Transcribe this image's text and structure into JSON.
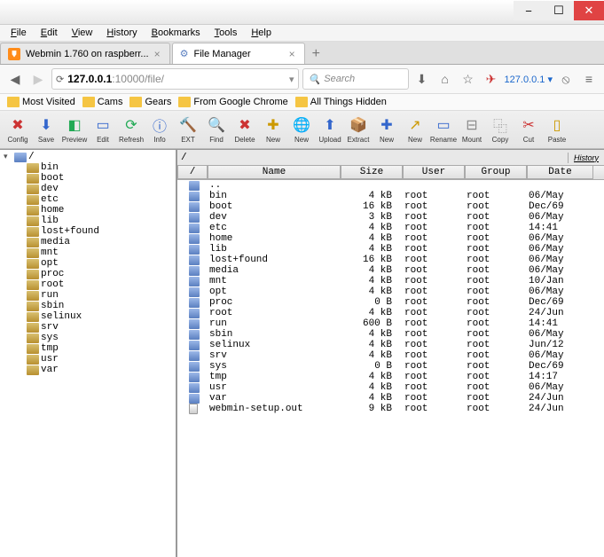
{
  "window": {
    "min": "−",
    "max": "☐",
    "close": "✕"
  },
  "menu": [
    "File",
    "Edit",
    "View",
    "History",
    "Bookmarks",
    "Tools",
    "Help"
  ],
  "tabs": [
    {
      "label": "Webmin 1.760 on raspberr...",
      "active": false
    },
    {
      "label": "File Manager",
      "active": true
    }
  ],
  "url": {
    "host": "127.0.0.1",
    "rest": ":10000/file/",
    "search_placeholder": "Search",
    "ip": "127.0.0.1"
  },
  "bookmarks": [
    "Most Visited",
    "Cams",
    "Gears",
    "From Google Chrome",
    "All Things Hidden"
  ],
  "tools": [
    {
      "l": "Config",
      "i": "✖",
      "c": "#c33"
    },
    {
      "l": "Save",
      "i": "⬇",
      "c": "#36c"
    },
    {
      "l": "Preview",
      "i": "◧",
      "c": "#2a5"
    },
    {
      "l": "Edit",
      "i": "▭",
      "c": "#36c"
    },
    {
      "l": "Refresh",
      "i": "⟳",
      "c": "#2a5"
    },
    {
      "l": "Info",
      "i": "ⓘ",
      "c": "#36c"
    },
    {
      "l": "EXT",
      "i": "🔨",
      "c": "#a63"
    },
    {
      "l": "Find",
      "i": "🔍",
      "c": "#888"
    },
    {
      "l": "Delete",
      "i": "✖",
      "c": "#c33"
    },
    {
      "l": "New",
      "i": "✚",
      "c": "#c90"
    },
    {
      "l": "New",
      "i": "🌐",
      "c": "#e70"
    },
    {
      "l": "Upload",
      "i": "⬆",
      "c": "#36c"
    },
    {
      "l": "Extract",
      "i": "📦",
      "c": "#a63"
    },
    {
      "l": "New",
      "i": "✚",
      "c": "#36c"
    },
    {
      "l": "New",
      "i": "↗",
      "c": "#c90"
    },
    {
      "l": "Rename",
      "i": "▭",
      "c": "#36c"
    },
    {
      "l": "Mount",
      "i": "⊟",
      "c": "#888"
    },
    {
      "l": "Copy",
      "i": "⿻",
      "c": "#888"
    },
    {
      "l": "Cut",
      "i": "✂",
      "c": "#c33"
    },
    {
      "l": "Paste",
      "i": "▯",
      "c": "#c90"
    }
  ],
  "tree_root": "/",
  "tree": [
    "bin",
    "boot",
    "dev",
    "etc",
    "home",
    "lib",
    "lost+found",
    "media",
    "mnt",
    "opt",
    "proc",
    "root",
    "run",
    "sbin",
    "selinux",
    "srv",
    "sys",
    "tmp",
    "usr",
    "var"
  ],
  "path": "/",
  "history_label": "History",
  "columns": {
    "name": "Name",
    "size": "Size",
    "user": "User",
    "group": "Group",
    "date": "Date"
  },
  "parent_row": "..",
  "files": [
    {
      "n": "bin",
      "s": "4 kB",
      "u": "root",
      "g": "root",
      "d": "06/May",
      "t": "d"
    },
    {
      "n": "boot",
      "s": "16 kB",
      "u": "root",
      "g": "root",
      "d": "Dec/69",
      "t": "d"
    },
    {
      "n": "dev",
      "s": "3 kB",
      "u": "root",
      "g": "root",
      "d": "06/May",
      "t": "d"
    },
    {
      "n": "etc",
      "s": "4 kB",
      "u": "root",
      "g": "root",
      "d": "14:41",
      "t": "d"
    },
    {
      "n": "home",
      "s": "4 kB",
      "u": "root",
      "g": "root",
      "d": "06/May",
      "t": "d"
    },
    {
      "n": "lib",
      "s": "4 kB",
      "u": "root",
      "g": "root",
      "d": "06/May",
      "t": "d"
    },
    {
      "n": "lost+found",
      "s": "16 kB",
      "u": "root",
      "g": "root",
      "d": "06/May",
      "t": "d"
    },
    {
      "n": "media",
      "s": "4 kB",
      "u": "root",
      "g": "root",
      "d": "06/May",
      "t": "d"
    },
    {
      "n": "mnt",
      "s": "4 kB",
      "u": "root",
      "g": "root",
      "d": "10/Jan",
      "t": "d"
    },
    {
      "n": "opt",
      "s": "4 kB",
      "u": "root",
      "g": "root",
      "d": "06/May",
      "t": "d"
    },
    {
      "n": "proc",
      "s": "0 B",
      "u": "root",
      "g": "root",
      "d": "Dec/69",
      "t": "d"
    },
    {
      "n": "root",
      "s": "4 kB",
      "u": "root",
      "g": "root",
      "d": "24/Jun",
      "t": "d"
    },
    {
      "n": "run",
      "s": "600 B",
      "u": "root",
      "g": "root",
      "d": "14:41",
      "t": "d"
    },
    {
      "n": "sbin",
      "s": "4 kB",
      "u": "root",
      "g": "root",
      "d": "06/May",
      "t": "d"
    },
    {
      "n": "selinux",
      "s": "4 kB",
      "u": "root",
      "g": "root",
      "d": "Jun/12",
      "t": "d"
    },
    {
      "n": "srv",
      "s": "4 kB",
      "u": "root",
      "g": "root",
      "d": "06/May",
      "t": "d"
    },
    {
      "n": "sys",
      "s": "0 B",
      "u": "root",
      "g": "root",
      "d": "Dec/69",
      "t": "d"
    },
    {
      "n": "tmp",
      "s": "4 kB",
      "u": "root",
      "g": "root",
      "d": "14:17",
      "t": "d"
    },
    {
      "n": "usr",
      "s": "4 kB",
      "u": "root",
      "g": "root",
      "d": "06/May",
      "t": "d"
    },
    {
      "n": "var",
      "s": "4 kB",
      "u": "root",
      "g": "root",
      "d": "24/Jun",
      "t": "d"
    },
    {
      "n": "webmin-setup.out",
      "s": "9 kB",
      "u": "root",
      "g": "root",
      "d": "24/Jun",
      "t": "f"
    }
  ]
}
